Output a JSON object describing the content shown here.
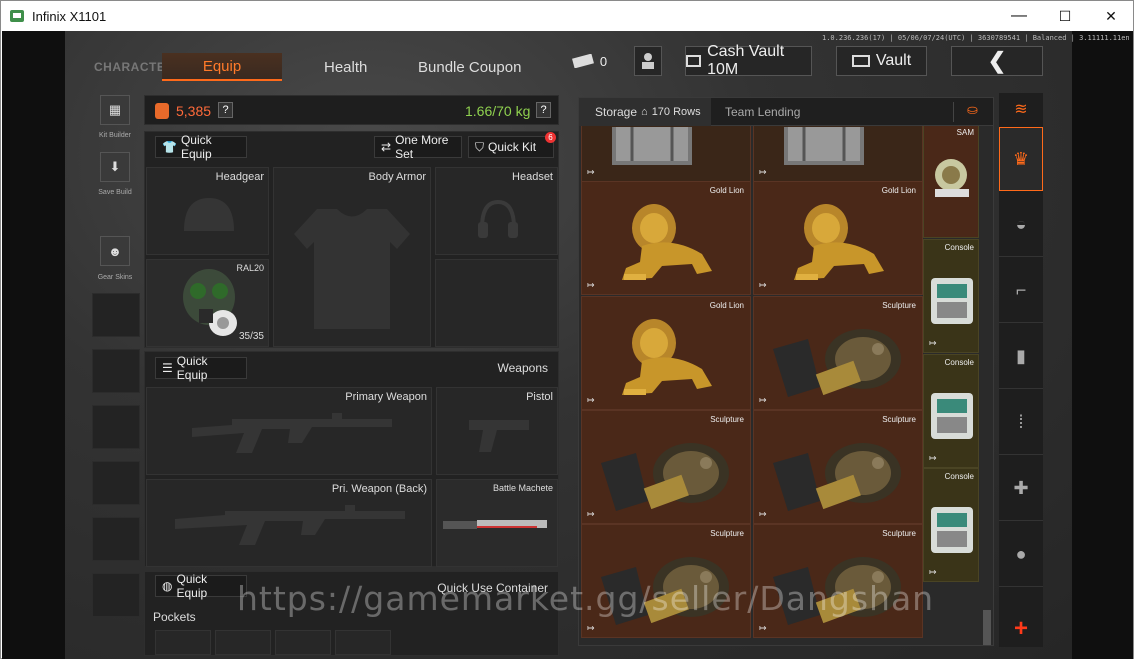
{
  "window": {
    "title": "Infinix X1101",
    "minimize": "—",
    "maximize": "☐",
    "close": "✕"
  },
  "version": "1.0.236.236(17) | 05/06/07/24(UTC) | 3630789541 | Balanced | 3.11111.11en",
  "tabs": {
    "character": "CHARACTER",
    "equip": "Equip",
    "health": "Health",
    "bundle": "Bundle Coupon"
  },
  "topbar": {
    "tickets": "0",
    "cash_vault": "Cash Vault 10M",
    "vault": "Vault",
    "back": "❮"
  },
  "sidebar": {
    "kit_builder": "Kit Builder",
    "save_build": "Save Build",
    "gear_skins": "Gear Skins"
  },
  "stats": {
    "money": "5,385",
    "weight": "1.66/70 kg",
    "help": "?"
  },
  "gear": {
    "quick_equip": "Quick Equip",
    "one_more_set": "One More Set",
    "quick_kit": "Quick Kit",
    "quick_kit_badge": "6",
    "headgear": "Headgear",
    "body_armor": "Body Armor",
    "headset": "Headset",
    "mask_name": "RAL20",
    "mask_durability": "35/35"
  },
  "weapons": {
    "quick_equip": "Quick Equip",
    "title": "Weapons",
    "primary": "Primary Weapon",
    "pistol": "Pistol",
    "primary_back": "Pri. Weapon (Back)",
    "melee": "Battle Machete"
  },
  "container": {
    "quick_equip": "Quick Equip",
    "title": "Quick Use Container",
    "pockets": "Pockets"
  },
  "storage": {
    "tab": "Storage",
    "rows": "170 Rows",
    "team_lending": "Team Lending",
    "items": [
      {
        "name": "",
        "kind": "case"
      },
      {
        "name": "",
        "kind": "case"
      },
      {
        "name": "Gold Lion",
        "kind": "lion"
      },
      {
        "name": "Gold Lion",
        "kind": "lion"
      },
      {
        "name": "Gold Lion",
        "kind": "lion"
      },
      {
        "name": "Sculpture",
        "kind": "sculpture"
      },
      {
        "name": "Sculpture",
        "kind": "sculpture"
      },
      {
        "name": "Sculpture",
        "kind": "sculpture"
      },
      {
        "name": "Sculpture",
        "kind": "sculpture"
      },
      {
        "name": "Sculpture",
        "kind": "sculpture"
      }
    ],
    "side_items": [
      {
        "name": "SAM",
        "kind": "medal"
      },
      {
        "name": "Console",
        "kind": "console"
      },
      {
        "name": "Console",
        "kind": "console"
      },
      {
        "name": "Console",
        "kind": "console"
      }
    ]
  },
  "categories": {
    "add": "+"
  },
  "watermark": "https://gamemarket.gg/seller/Dangshan",
  "colors": {
    "accent": "#ff6a1a",
    "weight": "#8fd14f",
    "storage_cell": "#4a2818",
    "side_cell": "#3a3418"
  }
}
